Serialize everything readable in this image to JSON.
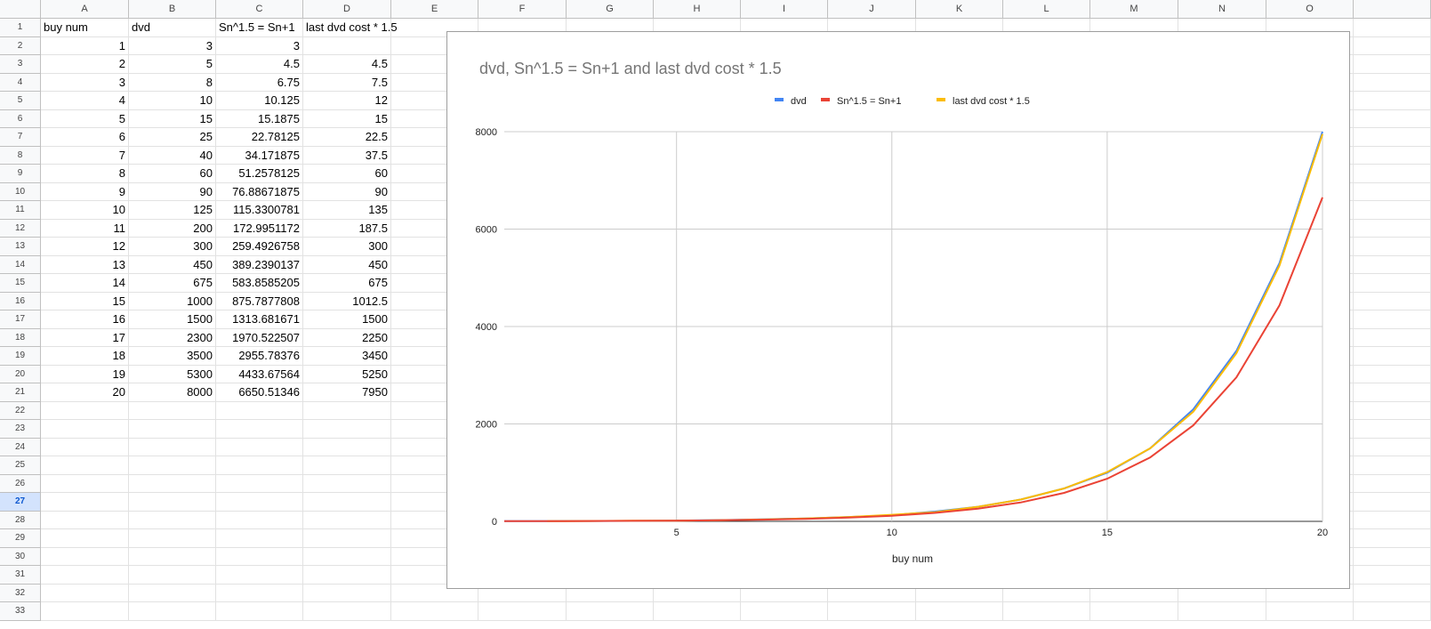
{
  "sheet": {
    "columns": [
      "A",
      "B",
      "C",
      "D",
      "E",
      "F",
      "G",
      "H",
      "I",
      "J",
      "K",
      "L",
      "M",
      "N",
      "O"
    ],
    "row_count": 33,
    "selected_row": 27,
    "header_row": [
      "buy num",
      "dvd",
      "Sn^1.5 = Sn+1",
      "last dvd cost * 1.5"
    ],
    "rows": [
      [
        "1",
        "3",
        "3",
        ""
      ],
      [
        "2",
        "5",
        "4.5",
        "4.5"
      ],
      [
        "3",
        "8",
        "6.75",
        "7.5"
      ],
      [
        "4",
        "10",
        "10.125",
        "12"
      ],
      [
        "5",
        "15",
        "15.1875",
        "15"
      ],
      [
        "6",
        "25",
        "22.78125",
        "22.5"
      ],
      [
        "7",
        "40",
        "34.171875",
        "37.5"
      ],
      [
        "8",
        "60",
        "51.2578125",
        "60"
      ],
      [
        "9",
        "90",
        "76.88671875",
        "90"
      ],
      [
        "10",
        "125",
        "115.3300781",
        "135"
      ],
      [
        "11",
        "200",
        "172.9951172",
        "187.5"
      ],
      [
        "12",
        "300",
        "259.4926758",
        "300"
      ],
      [
        "13",
        "450",
        "389.2390137",
        "450"
      ],
      [
        "14",
        "675",
        "583.8585205",
        "675"
      ],
      [
        "15",
        "1000",
        "875.7877808",
        "1012.5"
      ],
      [
        "16",
        "1500",
        "1313.681671",
        "1500"
      ],
      [
        "17",
        "2300",
        "1970.522507",
        "2250"
      ],
      [
        "18",
        "3500",
        "2955.78376",
        "3450"
      ],
      [
        "19",
        "5300",
        "4433.67564",
        "5250"
      ],
      [
        "20",
        "8000",
        "6650.51346",
        "7950"
      ]
    ]
  },
  "chart_data": {
    "type": "line",
    "title": "dvd, Sn^1.5 = Sn+1 and last dvd cost * 1.5",
    "xlabel": "buy num",
    "ylabel": "",
    "x": [
      1,
      2,
      3,
      4,
      5,
      6,
      7,
      8,
      9,
      10,
      11,
      12,
      13,
      14,
      15,
      16,
      17,
      18,
      19,
      20
    ],
    "xlim": [
      1,
      20
    ],
    "ylim": [
      0,
      8000
    ],
    "xticks": [
      "5",
      "10",
      "15",
      "20"
    ],
    "yticks": [
      "0",
      "2000",
      "4000",
      "6000",
      "8000"
    ],
    "grid": true,
    "legend_position": "top-right",
    "series": [
      {
        "name": "dvd",
        "color": "#4285f4",
        "values": [
          3,
          5,
          8,
          10,
          15,
          25,
          40,
          60,
          90,
          125,
          200,
          300,
          450,
          675,
          1000,
          1500,
          2300,
          3500,
          5300,
          8000
        ]
      },
      {
        "name": "Sn^1.5 = Sn+1",
        "color": "#ea4335",
        "values": [
          3,
          4.5,
          6.75,
          10.125,
          15.1875,
          22.78125,
          34.171875,
          51.2578125,
          76.88671875,
          115.3300781,
          172.9951172,
          259.4926758,
          389.2390137,
          583.8585205,
          875.7877808,
          1313.681671,
          1970.522507,
          2955.78376,
          4433.67564,
          6650.51346
        ]
      },
      {
        "name": "last dvd cost * 1.5",
        "color": "#fbbc04",
        "values": [
          null,
          4.5,
          7.5,
          12,
          15,
          22.5,
          37.5,
          60,
          90,
          135,
          187.5,
          300,
          450,
          675,
          1012.5,
          1500,
          2250,
          3450,
          5250,
          7950
        ]
      }
    ]
  }
}
